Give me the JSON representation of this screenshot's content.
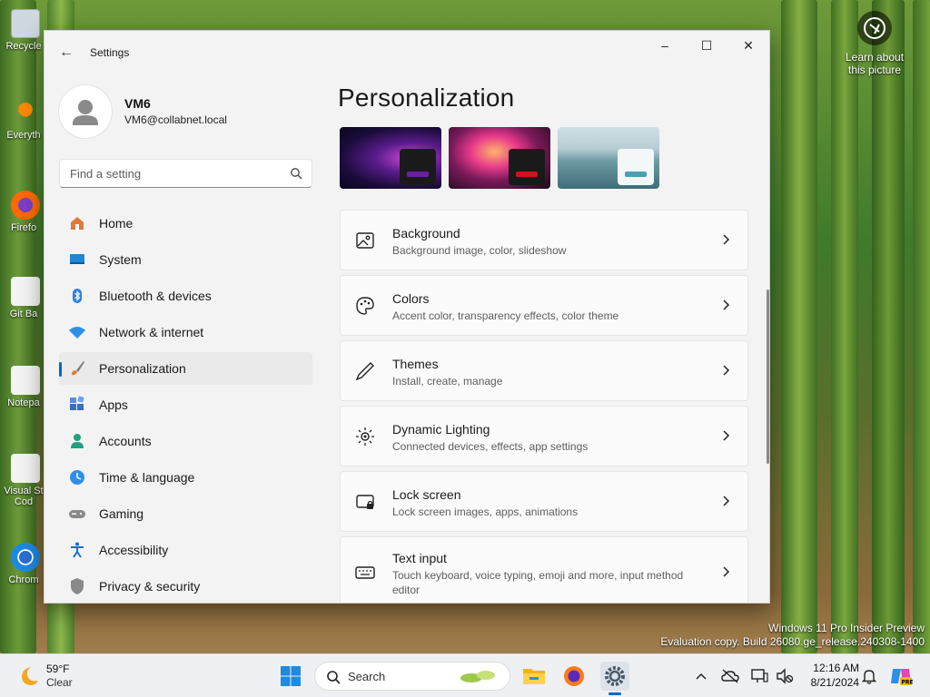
{
  "desktop": {
    "icons": [
      {
        "label": "Recycle"
      },
      {
        "label": "Everyth"
      },
      {
        "label": "Firefo"
      },
      {
        "label": "Git Ba"
      },
      {
        "label": "Notepa"
      },
      {
        "label": "Visual St Cod"
      },
      {
        "label": "Chrom"
      }
    ],
    "learn_line1": "Learn about",
    "learn_line2": "this picture",
    "watermark_line1": "Windows 11 Pro Insider Preview",
    "watermark_line2": "Evaluation copy. Build 26080.ge_release.240308-1400"
  },
  "window": {
    "title": "Settings",
    "controls": {
      "minimize": "–",
      "maximize": "☐",
      "close": "✕"
    }
  },
  "user": {
    "name": "VM6",
    "email": "VM6@collabnet.local"
  },
  "search": {
    "placeholder": "Find a setting"
  },
  "nav": [
    {
      "label": "Home",
      "icon": "home-icon"
    },
    {
      "label": "System",
      "icon": "system-icon"
    },
    {
      "label": "Bluetooth & devices",
      "icon": "bluetooth-icon"
    },
    {
      "label": "Network & internet",
      "icon": "wifi-icon"
    },
    {
      "label": "Personalization",
      "icon": "brush-icon",
      "selected": true
    },
    {
      "label": "Apps",
      "icon": "apps-icon"
    },
    {
      "label": "Accounts",
      "icon": "accounts-icon"
    },
    {
      "label": "Time & language",
      "icon": "globe-clock-icon"
    },
    {
      "label": "Gaming",
      "icon": "gamepad-icon"
    },
    {
      "label": "Accessibility",
      "icon": "accessibility-icon"
    },
    {
      "label": "Privacy & security",
      "icon": "shield-icon"
    }
  ],
  "page": {
    "title": "Personalization"
  },
  "themes": [
    {
      "name": "theme-dark-purple",
      "accent": "#6b1fa5"
    },
    {
      "name": "theme-dark-flower",
      "accent": "#d4101d"
    },
    {
      "name": "theme-light-lake",
      "accent": "#4aa0b0"
    }
  ],
  "cards": [
    {
      "title": "Background",
      "subtitle": "Background image, color, slideshow",
      "icon": "image-icon"
    },
    {
      "title": "Colors",
      "subtitle": "Accent color, transparency effects, color theme",
      "icon": "palette-icon"
    },
    {
      "title": "Themes",
      "subtitle": "Install, create, manage",
      "icon": "pen-icon"
    },
    {
      "title": "Dynamic Lighting",
      "subtitle": "Connected devices, effects, app settings",
      "icon": "lighting-icon"
    },
    {
      "title": "Lock screen",
      "subtitle": "Lock screen images, apps, animations",
      "icon": "lock-screen-icon"
    },
    {
      "title": "Text input",
      "subtitle": "Touch keyboard, voice typing, emoji and more, input method editor",
      "icon": "keyboard-icon"
    }
  ],
  "taskbar": {
    "weather_temp": "59°F",
    "weather_cond": "Clear",
    "search_label": "Search",
    "time": "12:16 AM",
    "date": "8/21/2024"
  },
  "colors": {
    "accent": "#0067c0"
  }
}
